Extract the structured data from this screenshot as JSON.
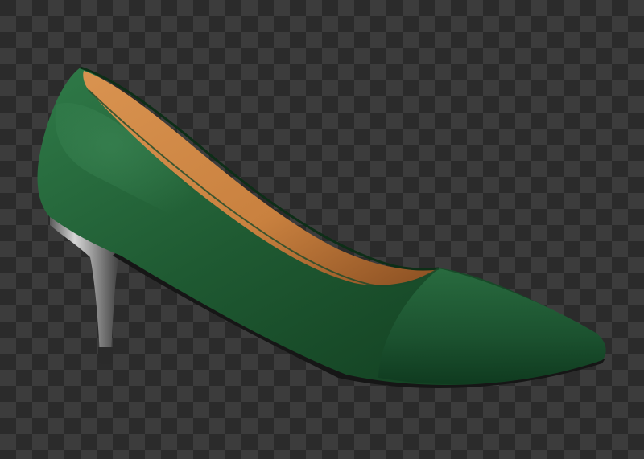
{
  "image": {
    "subject": "pump-shoe",
    "background": "transparency-checkerboard",
    "colors": {
      "checker_dark": "#2b2b2b",
      "checker_light": "#3c3c3c",
      "leather": "#1f5a32",
      "leather_highlight": "#2f7a48",
      "leather_shadow": "#103a1e",
      "lining": "#c9813f",
      "lining_shadow": "#8a4f22",
      "heel_metal": "#c9c9c9",
      "heel_shadow": "#4a4a4a",
      "sole": "#161616"
    }
  }
}
